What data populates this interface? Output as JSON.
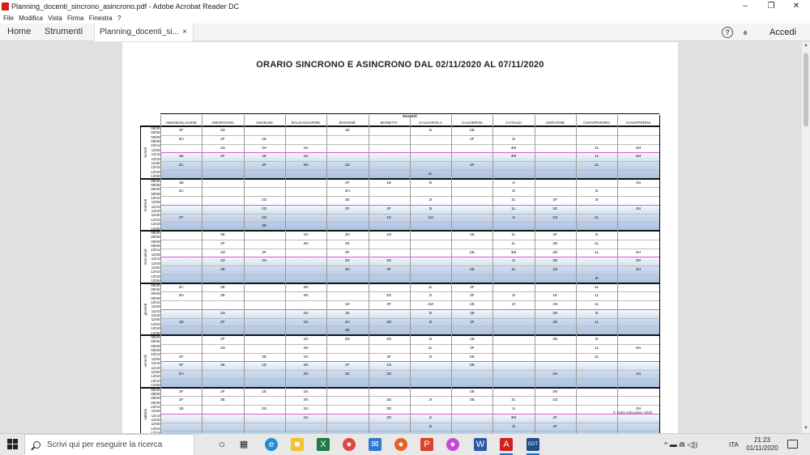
{
  "window": {
    "title": "Planning_docenti_sincrono_asincrono.pdf - Adobe Acrobat Reader DC",
    "minimize": "–",
    "maximize": "❐",
    "close": "✕"
  },
  "menu": [
    "File",
    "Modifica",
    "Vista",
    "Firma",
    "Finestra",
    "?"
  ],
  "tabs": {
    "home": "Home",
    "tools": "Strumenti",
    "document": "Planning_docenti_si...",
    "close": "×",
    "signin": "Accedi",
    "help": "?"
  },
  "icons": {
    "help": "help-circle-icon",
    "notifications": "bell-icon",
    "search": "search-icon",
    "start": "windows-start-icon"
  },
  "document": {
    "title": "ORARIO SINCRONO E ASINCRONO DAL 02/11/2020 AL 07/11/2020",
    "group_header": "Docenti",
    "teachers": [
      "AMENDOLAGINE",
      "AMOROSINI",
      "ANSELMI",
      "BALDASSARRE",
      "BARONE",
      "BONETTI",
      "CALDAROLA",
      "CALDERINI",
      "CATALDI",
      "CERVONE",
      "CHIAPPARINO",
      "CHIAPPERINI"
    ],
    "days": [
      "lunedì",
      "martedì",
      "mercoledì",
      "giovedì",
      "venerdì",
      "sabato"
    ],
    "time_slots": [
      "08h00",
      "08h50",
      "09h05",
      "09h55",
      "10h10",
      "11h00",
      "11h15",
      "11h45",
      "11h50",
      "12h20",
      "12h25",
      "12h55"
    ],
    "copyright": "© Index Education 2020",
    "schedule": [
      {
        "day": "lunedì",
        "morning": [
          [
            "3F",
            "1D",
            "",
            "",
            "1E",
            "",
            "2I",
            "2B",
            "",
            "",
            "",
            ""
          ],
          [
            "3H",
            "2F",
            "2E",
            "",
            "",
            "",
            "",
            "3F",
            "3I",
            "",
            "",
            ""
          ],
          [
            "",
            "1D",
            "3H",
            "1N",
            "",
            "",
            "",
            "",
            "3M",
            "",
            "2L",
            "1M"
          ]
        ],
        "afternoon": [
          [
            "1B",
            "2F",
            "2E",
            "1N",
            "",
            "",
            "",
            "",
            "3M",
            "",
            "1L",
            "1M"
          ],
          [
            "2C",
            "",
            "2F",
            "2N",
            "1D",
            "",
            "",
            "3F",
            "",
            "",
            "2L",
            ""
          ],
          [
            "",
            "",
            "",
            "",
            "",
            "",
            "2L",
            "",
            "",
            "",
            "",
            ""
          ]
        ]
      },
      {
        "day": "martedì",
        "morning": [
          [
            "1B",
            "",
            "",
            "",
            "2F",
            "1E",
            "2I",
            "",
            "1I",
            "",
            "",
            "1N"
          ],
          [
            "2C",
            "",
            "",
            "",
            "3H",
            "",
            "",
            "",
            "2I",
            "",
            "2I",
            ""
          ],
          [
            "",
            "",
            "2G",
            "",
            "3E",
            "",
            "2I",
            "",
            "2L",
            "2F",
            "3I",
            ""
          ]
        ],
        "afternoon": [
          [
            "",
            "",
            "2G",
            "",
            "3F",
            "2F",
            "3I",
            "",
            "1L",
            "1E",
            "",
            "2N"
          ],
          [
            "2F",
            "",
            "3G",
            "",
            "",
            "1E",
            "1M",
            "",
            "1I",
            "1N",
            "2L",
            ""
          ],
          [
            "",
            "",
            "3E",
            "",
            "",
            "",
            "",
            "",
            "",
            "",
            "",
            ""
          ]
        ]
      },
      {
        "day": "mercoledì",
        "morning": [
          [
            "",
            "3E",
            "",
            "1N",
            "3D",
            "1D",
            "",
            "1B",
            "1L",
            "3F",
            "3I",
            ""
          ],
          [
            "",
            "2F",
            "",
            "2N",
            "2E",
            "",
            "",
            "",
            "1L",
            "3D",
            "2L",
            ""
          ],
          [
            "",
            "1D",
            "2F",
            "",
            "3F",
            "",
            "",
            "2B",
            "3M",
            "2D",
            "1L",
            "3H"
          ]
        ],
        "afternoon": [
          [
            "",
            "1D",
            "3H",
            "",
            "2D",
            "3G",
            "",
            "",
            "2I",
            "3D",
            "",
            "3N"
          ],
          [
            "",
            "3E",
            "",
            "",
            "3D",
            "3F",
            "",
            "2B",
            "2L",
            "1D",
            "",
            "3H"
          ],
          [
            "",
            "",
            "",
            "",
            "",
            "",
            "",
            "",
            "",
            "",
            "3I",
            ""
          ]
        ]
      },
      {
        "day": "giovedì",
        "morning": [
          [
            "2C",
            "3E",
            "",
            "2N",
            "",
            "",
            "1L",
            "3F",
            "",
            "",
            "2L",
            ""
          ],
          [
            "3H",
            "3E",
            "",
            "2N",
            "",
            "2G",
            "1I",
            "3F",
            "3I",
            "1E",
            "1L",
            ""
          ],
          [
            "",
            "",
            "",
            "",
            "1D",
            "2F",
            "1M",
            "1B",
            "2I",
            "1N",
            "1L",
            ""
          ]
        ],
        "afternoon": [
          [
            "",
            "1D",
            "",
            "1N",
            "1E",
            "",
            "2I",
            "1B",
            "",
            "2N",
            "3I",
            ""
          ],
          [
            "1B",
            "2F",
            "",
            "1N",
            "3H",
            "3D",
            "2I",
            "3F",
            "",
            "2D",
            "1L",
            ""
          ],
          [
            "",
            "",
            "",
            "",
            "3E",
            "",
            "",
            "",
            "",
            "",
            "",
            ""
          ]
        ]
      },
      {
        "day": "venerdì",
        "morning": [
          [
            "",
            "2F",
            "",
            "1N",
            "2D",
            "3G",
            "2I",
            "1B",
            "",
            "3N",
            "3I",
            ""
          ],
          [
            "",
            "1D",
            "",
            "2N",
            "",
            "",
            "2L",
            "3F",
            "",
            "",
            "1L",
            "2N"
          ],
          [
            "2F",
            "",
            "3E",
            "1N",
            "",
            "3F",
            "2I",
            "2B",
            "",
            "",
            "2L",
            ""
          ]
        ],
        "afternoon": [
          [
            "3F",
            "3E",
            "1E",
            "2N",
            "2F",
            "1D",
            "",
            "2B",
            "",
            "",
            "",
            ""
          ],
          [
            "3H",
            "",
            "",
            "2N",
            "2E",
            "2D",
            "",
            "",
            "",
            "2N",
            "",
            "1N"
          ],
          [
            "",
            "",
            "",
            "",
            "",
            "",
            "",
            "",
            "",
            "",
            "",
            ""
          ]
        ]
      },
      {
        "day": "sabato",
        "morning": [
          [
            "3F",
            "2F",
            "1E",
            "1N",
            "",
            "",
            "",
            "1B",
            "",
            "2N",
            "",
            ""
          ],
          [
            "2F",
            "3E",
            "",
            "2N",
            "",
            "2D",
            "2I",
            "2B",
            "2L",
            "1D",
            "",
            ""
          ],
          [
            "1B",
            "",
            "3G",
            "1N",
            "",
            "3D",
            "",
            "",
            "1I",
            "",
            "",
            "2N"
          ]
        ],
        "afternoon": [
          [
            "",
            "",
            "",
            "1N",
            "",
            "2D",
            "1I",
            "",
            "3M",
            "2F",
            "",
            ""
          ],
          [
            "",
            "",
            "",
            "",
            "",
            "",
            "2I",
            "",
            "3I",
            "3F",
            "",
            ""
          ],
          [
            "",
            "",
            "",
            "",
            "",
            "",
            "1L",
            "",
            "",
            "",
            "",
            ""
          ]
        ]
      }
    ]
  },
  "taskbar": {
    "search_placeholder": "Scrivi qui per eseguire la ricerca",
    "time": "21:23",
    "date": "01/11/2020",
    "language": "ITA",
    "tray_icons": "^ ▬ ⋒ ◁))"
  },
  "colors": {
    "acrobat_red": "#d2201b",
    "afternoon_blue": "#a9c1e0",
    "divider_pink": "#d55bd5"
  }
}
